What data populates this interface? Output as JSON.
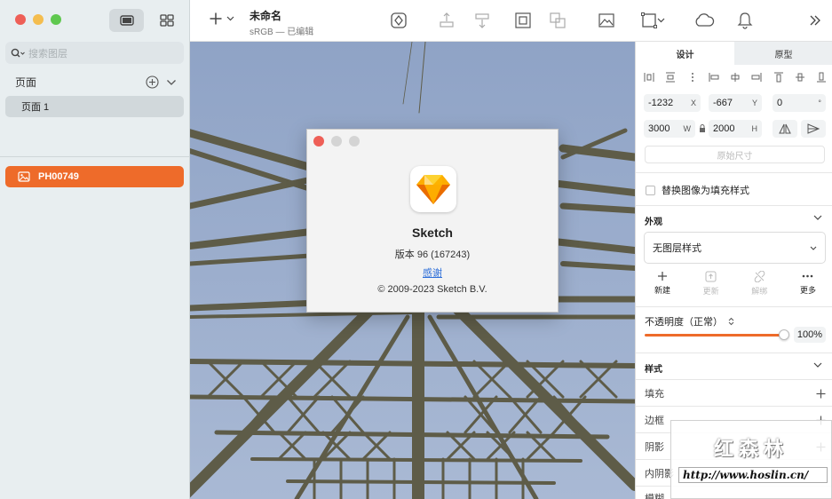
{
  "window": {
    "doc_name": "未命名",
    "doc_sub": "sRGB — 已编辑"
  },
  "sidebar": {
    "search_placeholder": "搜索图层",
    "pages_title": "页面",
    "pages": [
      "页面 1"
    ],
    "layers": [
      {
        "name": "PH00749",
        "selected": true
      }
    ]
  },
  "dialog": {
    "app_name": "Sketch",
    "version": "版本 96 (167243)",
    "thanks": "感谢",
    "copyright": "© 2009-2023 Sketch B.V."
  },
  "inspector": {
    "tabs": [
      "设计",
      "原型"
    ],
    "x": "-1232",
    "x_label": "X",
    "y": "-667",
    "y_label": "Y",
    "rotation": "0",
    "rotation_unit": "°",
    "w": "3000",
    "w_label": "W",
    "h": "2000",
    "h_label": "H",
    "original_size": "原始尺寸",
    "replace_fill": "替换图像为填充样式",
    "appearance_title": "外观",
    "layer_style": "无图层样式",
    "actions": {
      "new": "新建",
      "update": "更新",
      "detach": "解绑",
      "more": "更多"
    },
    "opacity_label": "不透明度（正常）",
    "opacity_value": "100%",
    "opacity": 1.0,
    "style_title": "样式",
    "fill": "填充",
    "border": "边框",
    "shadow": "阴影",
    "inner_shadow": "内阴影",
    "blur": "模糊"
  },
  "watermark": {
    "cn": "红森林",
    "url": "http://www.hoslin.cn/"
  },
  "colors": {
    "accent": "#ee6b2a",
    "link": "#2e6fd9",
    "sky": "#9aaccc"
  }
}
